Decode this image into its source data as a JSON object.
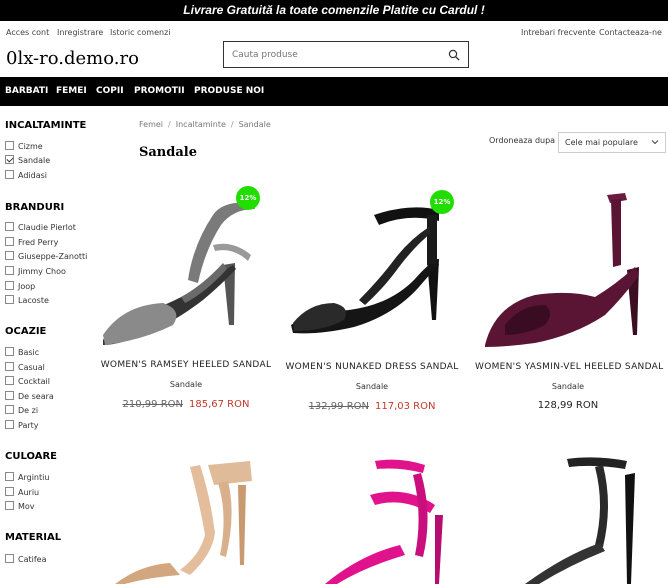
{
  "banner": {
    "text": "Livrare Gratuită la toate comenzile Platite cu Cardul !"
  },
  "toplinks": {
    "account": "Acces cont",
    "register": "Inregistrare",
    "history": "Istoric comenzi",
    "faq": "Intrebari frecvente",
    "contact": "Contacteaza-ne"
  },
  "logo": {
    "text": "0lx-ro.demo.ro"
  },
  "search": {
    "placeholder": "Cauta produse",
    "icon": "search-icon"
  },
  "nav": {
    "items": [
      "BARBATI",
      "FEMEI",
      "COPII",
      "PROMOTII",
      "PRODUSE NOI"
    ]
  },
  "facets": [
    {
      "title": "INCALTAMINTE",
      "options": [
        {
          "label": "Cizme",
          "checked": false
        },
        {
          "label": "Sandale",
          "checked": true
        },
        {
          "label": "Adidasi",
          "checked": false
        }
      ]
    },
    {
      "title": "BRANDURI",
      "options": [
        {
          "label": "Claudie Pierlot",
          "checked": false
        },
        {
          "label": "Fred Perry",
          "checked": false
        },
        {
          "label": "Giuseppe-Zanotti",
          "checked": false
        },
        {
          "label": "Jimmy Choo",
          "checked": false
        },
        {
          "label": "Joop",
          "checked": false
        },
        {
          "label": "Lacoste",
          "checked": false
        }
      ]
    },
    {
      "title": "OCAZIE",
      "options": [
        {
          "label": "Basic",
          "checked": false
        },
        {
          "label": "Casual",
          "checked": false
        },
        {
          "label": "Cocktail",
          "checked": false
        },
        {
          "label": "De seara",
          "checked": false
        },
        {
          "label": "De zi",
          "checked": false
        },
        {
          "label": "Party",
          "checked": false
        }
      ]
    },
    {
      "title": "CULOARE",
      "options": [
        {
          "label": "Argintiu",
          "checked": false
        },
        {
          "label": "Auriu",
          "checked": false
        },
        {
          "label": "Mov",
          "checked": false
        }
      ]
    },
    {
      "title": "MATERIAL",
      "options": [
        {
          "label": "Catifea",
          "checked": false
        }
      ]
    }
  ],
  "breadcrumb": [
    "Femei",
    "Incaltaminte",
    "Sandale"
  ],
  "page_title": "Sandale",
  "sort": {
    "label": "Ordoneaza dupa",
    "selected": "Cele mai populare"
  },
  "products": [
    {
      "name": "WOMEN'S RAMSEY HEELED SANDAL",
      "category": "Sandale",
      "old_price": "210,99 RON",
      "price": "185,67 RON",
      "badge": "12%",
      "color": "#6e6e6e"
    },
    {
      "name": "WOMEN'S NUNAKED DRESS SANDAL",
      "category": "Sandale",
      "old_price": "132,99 RON",
      "price": "117,03 RON",
      "badge": "12%",
      "color": "#111111"
    },
    {
      "name": "WOMEN'S YASMIN-VEL HEELED SANDAL",
      "category": "Sandale",
      "old_price": "",
      "price": "128,99 RON",
      "badge": "",
      "color": "#5a1535"
    }
  ],
  "colors": {
    "badge": "#22dd00",
    "sale_price": "#c0392b",
    "bar": "#000000"
  }
}
